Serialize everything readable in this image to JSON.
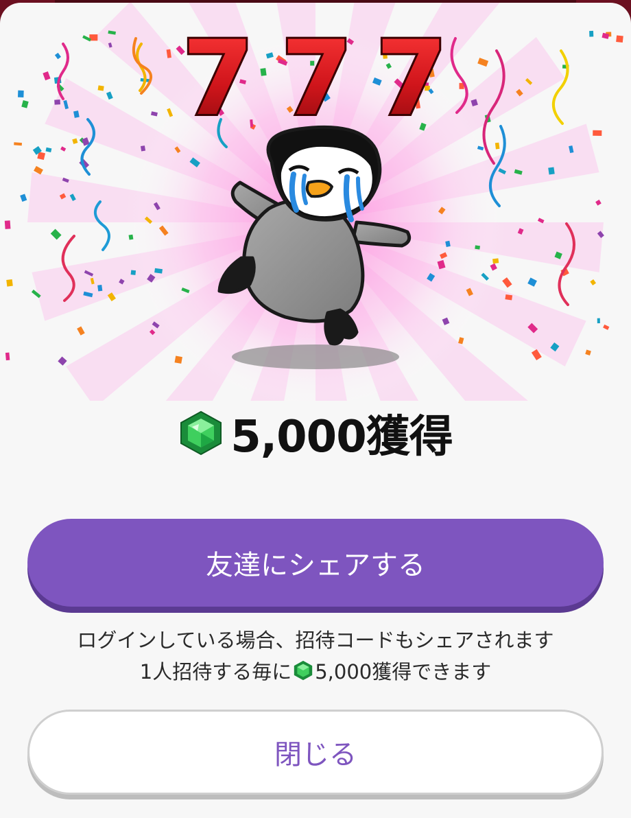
{
  "dialog": {
    "jackpot_digits": [
      "7",
      "7",
      "7"
    ],
    "reward_text": "5,000獲得",
    "reward_icon": "green-gem-icon",
    "share_button_label": "友達にシェアする",
    "note_line1": "ログインしている場合、招待コードもシェアされます",
    "note_line2_prefix": "1人招待する毎に",
    "note_line2_suffix": "5,000獲得できます",
    "close_button_label": "閉じる"
  },
  "colors": {
    "accent": "#7e55bf",
    "accent_shadow": "#5b3a92",
    "seven_red": "#d0151b",
    "gem_green": "#22b04a",
    "background": "#f7f7f7"
  }
}
